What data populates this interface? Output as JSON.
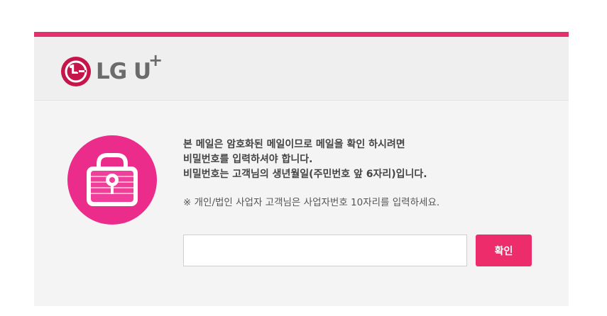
{
  "brand": {
    "name": "LG U",
    "plus": "+",
    "logo_icon": "lg-face-logo-icon"
  },
  "colors": {
    "accent": "#e6306e",
    "logo_red": "#c6154b",
    "button": "#ec2c6b"
  },
  "message": {
    "lines": [
      "본 메일은 암호화된 메일이므로 메일을 확인 하시려면",
      "비밀번호를 입력하셔야 합니다.",
      "비밀번호는 고객님의 생년월일(주민번호 앞 6자리)입니다."
    ],
    "note": "※ 개인/법인 사업자 고객님은 사업자번호 10자리를 입력하세요."
  },
  "form": {
    "password_value": "",
    "password_placeholder": "",
    "confirm_label": "확인"
  },
  "icons": {
    "lock": "lock-icon"
  }
}
